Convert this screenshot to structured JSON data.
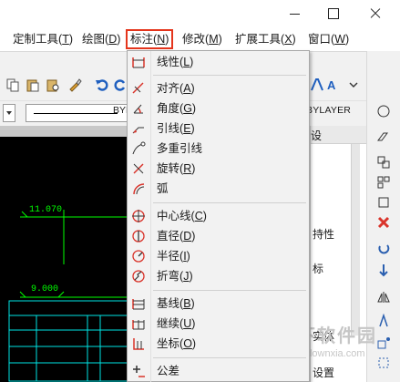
{
  "window": {
    "minimize": "minimize",
    "maximize": "maximize",
    "close": "close"
  },
  "menubar": [
    {
      "label": "定制工具",
      "accel": "T"
    },
    {
      "label": "绘图",
      "accel": "D"
    },
    {
      "label": "标注",
      "accel": "N"
    },
    {
      "label": "修改",
      "accel": "M"
    },
    {
      "label": "扩展工具",
      "accel": "X"
    },
    {
      "label": "窗口",
      "accel": "W"
    }
  ],
  "toolbar": {
    "linetype": "BYL",
    "lineweight": "BYLAYER"
  },
  "canvas": {
    "dim1": "11.070",
    "dim2": "9.000"
  },
  "panel": {
    "title_fragment": "设",
    "text_1": "持性",
    "text_2": "标",
    "text_3": "实体",
    "text_4": "设置"
  },
  "dimension_menu": {
    "items": [
      {
        "label": "线性",
        "accel": "L",
        "icon": "linear-dim-icon"
      },
      {
        "label": "对齐",
        "accel": "A",
        "icon": "aligned-dim-icon"
      },
      {
        "label": "角度",
        "accel": "G",
        "icon": "angle-dim-icon"
      },
      {
        "label": "引线",
        "accel": "E",
        "icon": "leader-icon"
      },
      {
        "label": "多重引线",
        "accel": "",
        "icon": "multileader-icon"
      },
      {
        "label": "旋转",
        "accel": "R",
        "icon": "rotated-dim-icon"
      },
      {
        "label": "弧",
        "accel": "",
        "icon": "arc-dim-icon"
      },
      {
        "label": "中心线",
        "accel": "C",
        "icon": "centerline-icon"
      },
      {
        "label": "直径",
        "accel": "D",
        "icon": "diameter-icon"
      },
      {
        "label": "半径",
        "accel": "I",
        "icon": "radius-icon"
      },
      {
        "label": "折弯",
        "accel": "J",
        "icon": "jogged-icon"
      },
      {
        "label": "基线",
        "accel": "B",
        "icon": "baseline-icon"
      },
      {
        "label": "继续",
        "accel": "U",
        "icon": "continue-icon"
      },
      {
        "label": "坐标",
        "accel": "O",
        "icon": "ordinate-icon"
      },
      {
        "label": "公差",
        "accel": "",
        "icon": "tolerance-icon"
      }
    ]
  },
  "watermark": {
    "text": "当下软件园",
    "url": "www.downxia.com"
  },
  "colors": {
    "highlight_border": "#e4351c",
    "canvas_bg": "#000000",
    "dim_green": "#00ff00",
    "icon_red": "#d9342b",
    "icon_blue": "#2a5fb0"
  }
}
